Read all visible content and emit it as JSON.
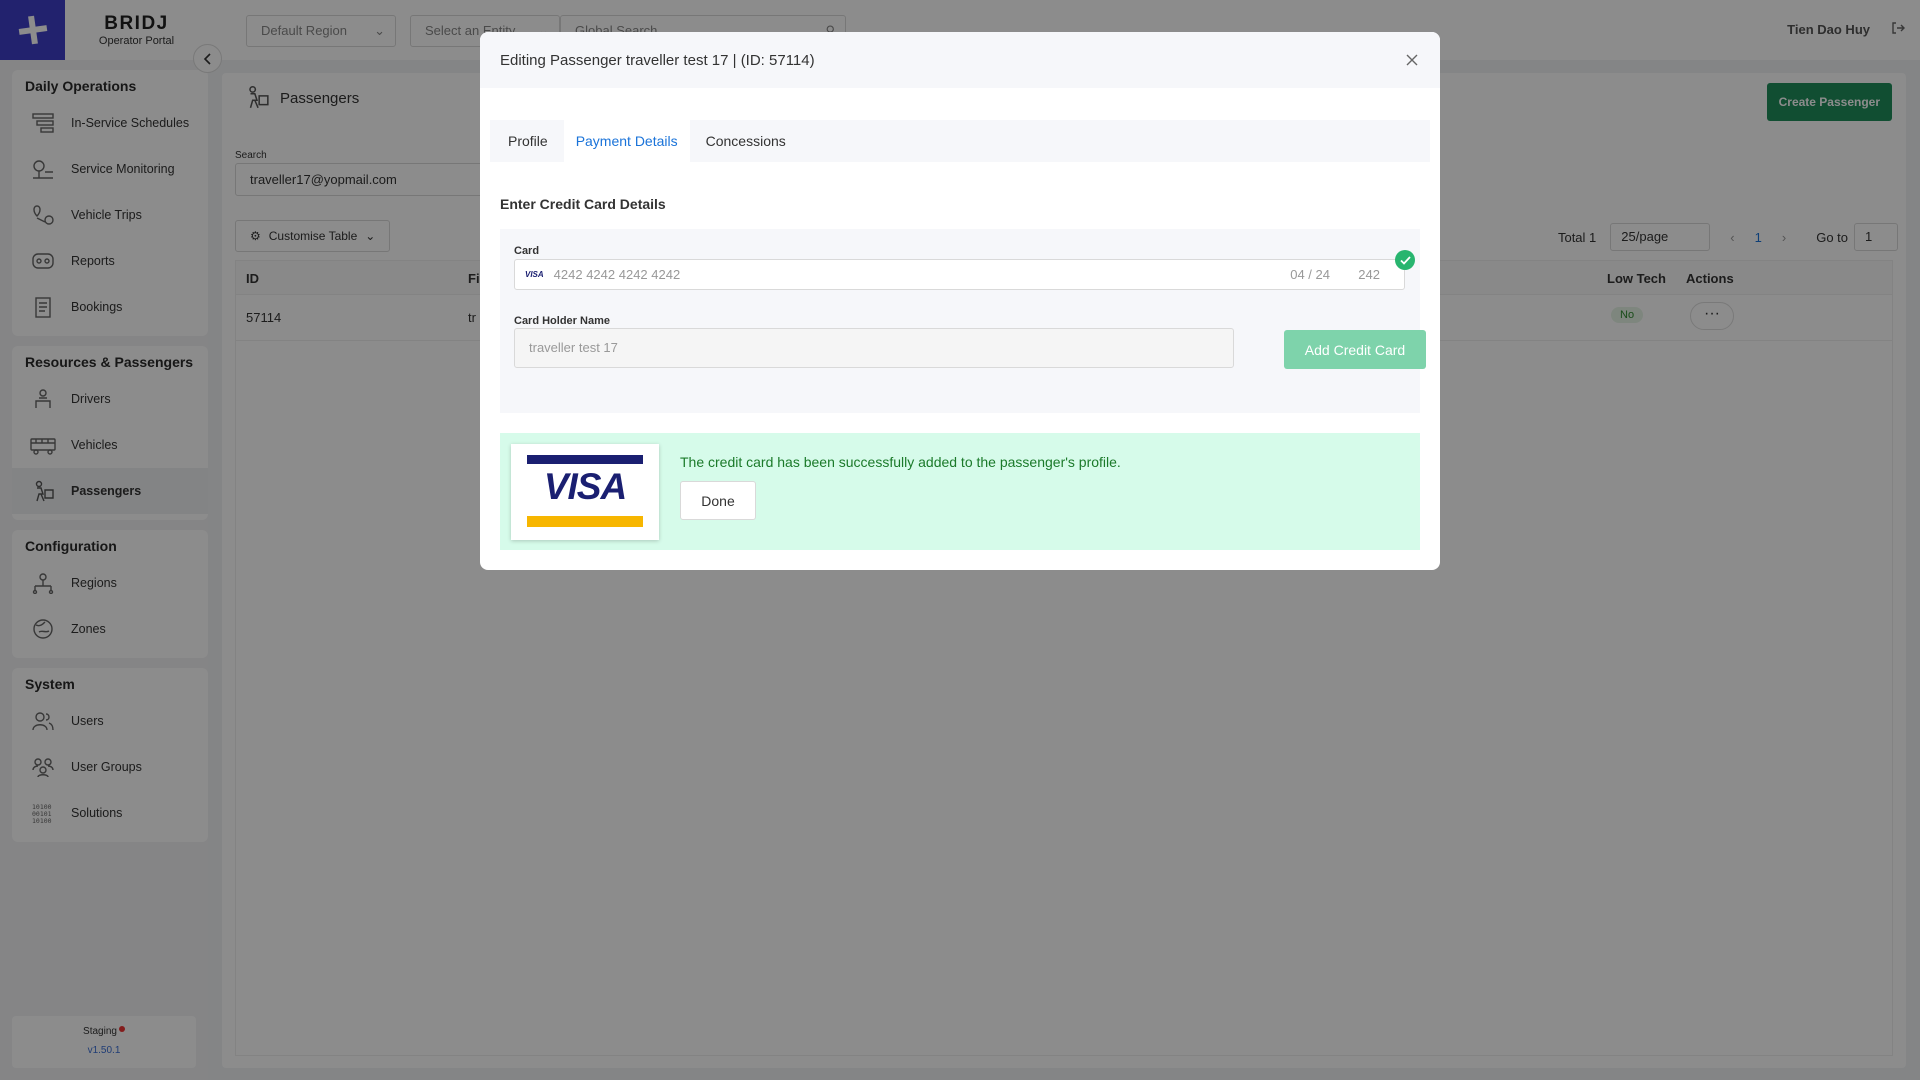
{
  "brand": {
    "name": "BRIDJ",
    "subtitle": "Operator Portal"
  },
  "sidebar": {
    "sections": [
      {
        "title": "Daily Operations",
        "items": [
          {
            "label": "In-Service Schedules",
            "icon": "schedule-icon"
          },
          {
            "label": "Service Monitoring",
            "icon": "monitoring-icon"
          },
          {
            "label": "Vehicle Trips",
            "icon": "trips-icon"
          },
          {
            "label": "Reports",
            "icon": "reports-icon"
          },
          {
            "label": "Bookings",
            "icon": "bookings-icon"
          }
        ]
      },
      {
        "title": "Resources & Passengers",
        "items": [
          {
            "label": "Drivers",
            "icon": "driver-icon"
          },
          {
            "label": "Vehicles",
            "icon": "vehicle-icon"
          },
          {
            "label": "Passengers",
            "icon": "passenger-icon",
            "active": true
          }
        ]
      },
      {
        "title": "Configuration",
        "items": [
          {
            "label": "Regions",
            "icon": "regions-icon"
          },
          {
            "label": "Zones",
            "icon": "zones-icon"
          }
        ]
      },
      {
        "title": "System",
        "items": [
          {
            "label": "Users",
            "icon": "users-icon"
          },
          {
            "label": "User Groups",
            "icon": "user-groups-icon"
          },
          {
            "label": "Solutions",
            "icon": "solutions-icon"
          }
        ]
      }
    ],
    "environment": "Staging",
    "version": "v1.50.1"
  },
  "topbar": {
    "region_select": "Default Region",
    "entity_select": "Select an Entity",
    "global_search_placeholder": "Global Search",
    "user_name": "Tien Dao Huy"
  },
  "main": {
    "title": "Passengers",
    "create_button": "Create Passenger",
    "search_label": "Search",
    "search_value": "traveller17@yopmail.com",
    "customise_button": "Customise Table",
    "pager": {
      "total": "Total 1",
      "page_size": "25/page",
      "current_page": "1",
      "goto_label": "Go to",
      "goto_value": "1"
    },
    "table": {
      "columns": [
        "ID",
        "Fi",
        "Low Tech",
        "Actions"
      ],
      "rows": [
        {
          "id": "57114",
          "first": "tr",
          "low_tech": "No",
          "actions": "···"
        }
      ]
    }
  },
  "modal": {
    "title": "Editing Passenger traveller test 17 | (ID: 57114)",
    "tabs": [
      "Profile",
      "Payment Details",
      "Concessions"
    ],
    "active_tab": "Payment Details",
    "section_title": "Enter Credit Card Details",
    "card_label": "Card",
    "card_brand": "VISA",
    "card_number": "4242 4242 4242 4242",
    "card_expiry": "04 / 24",
    "card_cvc": "242",
    "holder_label": "Card Holder Name",
    "holder_value": "traveller test 17",
    "add_button": "Add Credit Card",
    "success_message": "The credit card has been successfully added to the passenger's profile.",
    "done_button": "Done",
    "visa_logo_text": "VISA"
  },
  "colors": {
    "brand": "#3f3fc9",
    "accent_blue": "#1a73d9",
    "create_green": "#1f8f5c",
    "add_button_green": "#7ed3ab",
    "success_bg": "#d6fbea",
    "visa_blue": "#1a1f71",
    "visa_gold": "#f7b600"
  }
}
